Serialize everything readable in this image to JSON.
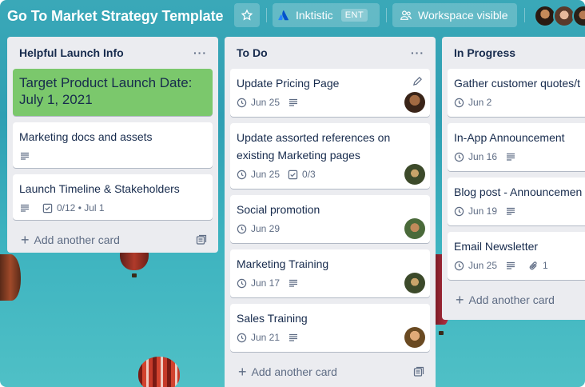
{
  "header": {
    "board_title": "Go To Market Strategy Template",
    "workspace_name": "Inktistic",
    "workspace_badge": "ENT",
    "visibility_label": "Workspace visible",
    "star_icon": "star-icon",
    "workspace_icon": "atlassian-logo-icon",
    "visibility_icon": "people-icon"
  },
  "lists": [
    {
      "title": "Helpful Launch Info",
      "menu": "···",
      "cards": [
        {
          "title": "Target Product Launch Date: July 1, 2021",
          "cover_color": "#7bc86c"
        },
        {
          "title": "Marketing docs and assets",
          "has_description": true
        },
        {
          "title": "Launch Timeline & Stakeholders",
          "has_description": true,
          "checklist": "0/12",
          "due": "Jul 1"
        }
      ],
      "add_card_label": "Add another card"
    },
    {
      "title": "To Do",
      "menu": "···",
      "cards": [
        {
          "title": "Update Pricing Page",
          "due": "Jun 25",
          "has_description": true
        },
        {
          "title": "Update assorted references on existing Marketing pages",
          "due": "Jun 25",
          "checklist": "0/3"
        },
        {
          "title": "Social promotion",
          "due": "Jun 29"
        },
        {
          "title": "Marketing Training",
          "due": "Jun 17",
          "has_description": true
        },
        {
          "title": "Sales Training",
          "due": "Jun 21",
          "has_description": true
        }
      ],
      "add_card_label": "Add another card"
    },
    {
      "title": "In Progress",
      "cards": [
        {
          "title": "Gather customer quotes/t",
          "due": "Jun 2"
        },
        {
          "title": "In-App Announcement",
          "due": "Jun 16",
          "has_description": true
        },
        {
          "title": "Blog post - Announcemen",
          "due": "Jun 19",
          "has_description": true
        },
        {
          "title": "Email Newsletter",
          "due": "Jun 25",
          "has_description": true,
          "attachments": "1"
        }
      ],
      "add_card_label": "Add another card"
    }
  ],
  "colors": {
    "board_background": "#3aa8b8",
    "list_background": "#ebecf0",
    "green_label": "#7bc86c",
    "text_primary": "#172b4d",
    "text_secondary": "#5e6c84"
  }
}
